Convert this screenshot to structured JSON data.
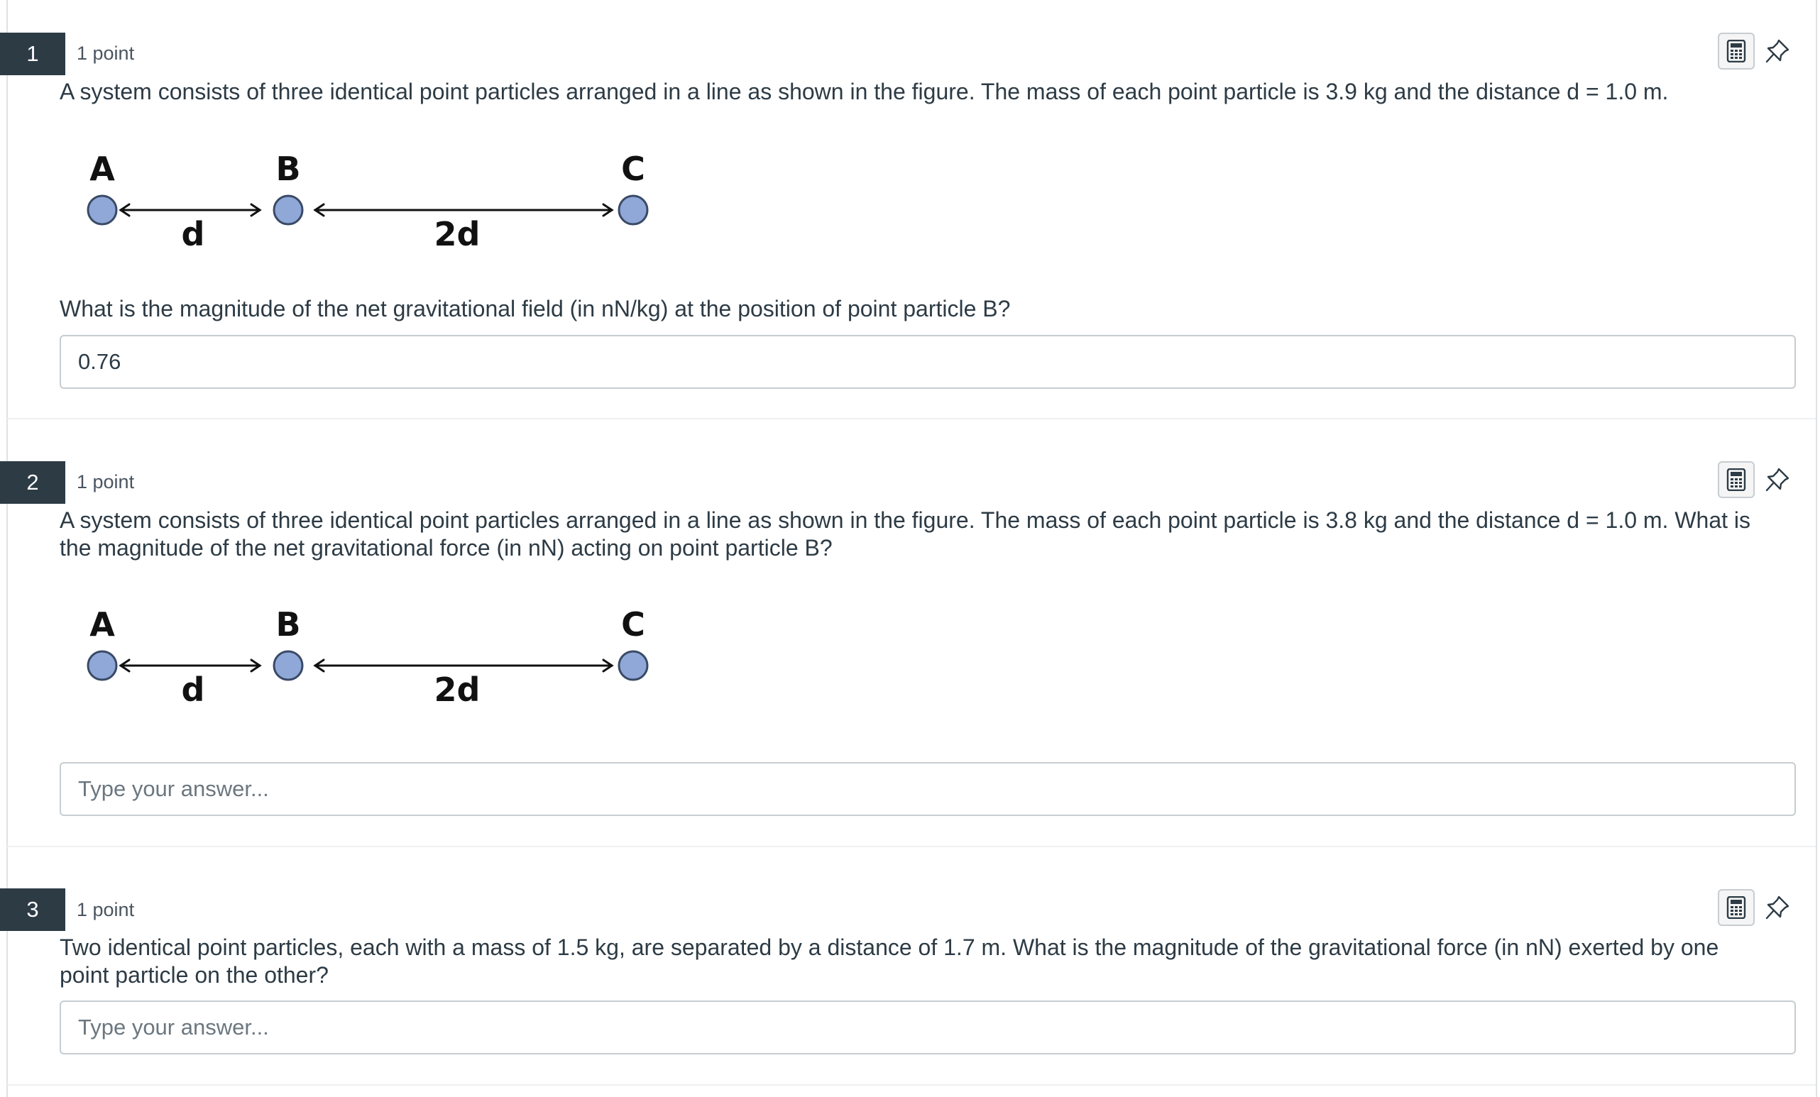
{
  "questions": [
    {
      "number": "1",
      "points": "1 point",
      "text": "A system consists of three identical point particles arranged in a line as shown in the figure. The mass of each point particle is 3.9 kg and the distance d = 1.0 m.",
      "followup": "What is the magnitude of the net gravitational field (in nN/kg) at the position of point particle B?",
      "figure": {
        "labels": [
          "A",
          "B",
          "C"
        ],
        "distance_labels": [
          "d",
          "2d"
        ]
      },
      "answer": {
        "value": "0.76",
        "placeholder": "Type your answer..."
      }
    },
    {
      "number": "2",
      "points": "1 point",
      "text": "A system consists of three identical point particles arranged in a line as shown in the figure. The mass of each point particle is 3.8 kg and the distance d = 1.0 m. What is the magnitude of the net gravitational force (in nN) acting on point particle B?",
      "figure": {
        "labels": [
          "A",
          "B",
          "C"
        ],
        "distance_labels": [
          "d",
          "2d"
        ]
      },
      "answer": {
        "value": "",
        "placeholder": "Type your answer..."
      }
    },
    {
      "number": "3",
      "points": "1 point",
      "text": "Two identical point particles, each with a mass of 1.5 kg, are separated by a distance of 1.7 m. What is the magnitude of the gravitational force (in nN) exerted by one point particle on the other?",
      "answer": {
        "value": "",
        "placeholder": "Type your answer..."
      }
    }
  ],
  "icons": {
    "calculator": "calculator-icon",
    "pin": "pin-icon"
  },
  "colors": {
    "number_badge": "#2d3b45",
    "particle": "#8fa8d8",
    "border": "#c7cdd1"
  }
}
